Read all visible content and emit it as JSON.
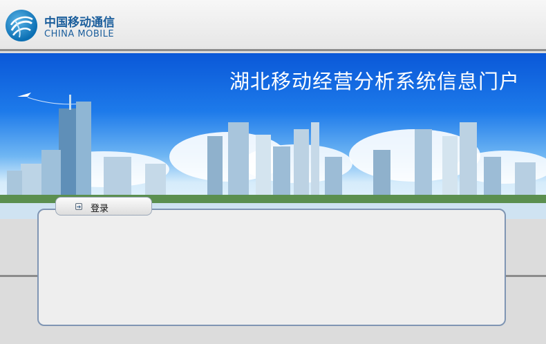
{
  "logo": {
    "cn": "中国移动通信",
    "en": "CHINA MOBILE"
  },
  "banner": {
    "title": "湖北移动经营分析系统信息门户"
  },
  "login_tab": {
    "label": "登录"
  }
}
